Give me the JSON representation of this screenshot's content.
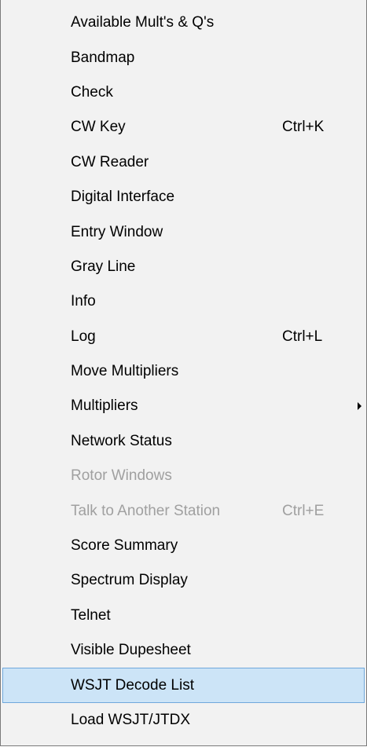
{
  "menu": {
    "items": [
      {
        "label": "Available Mult's & Q's",
        "shortcut": ""
      },
      {
        "label": "Bandmap",
        "shortcut": ""
      },
      {
        "label": "Check",
        "shortcut": ""
      },
      {
        "label": "CW Key",
        "shortcut": "Ctrl+K"
      },
      {
        "label": "CW Reader",
        "shortcut": ""
      },
      {
        "label": "Digital Interface",
        "shortcut": ""
      },
      {
        "label": "Entry Window",
        "shortcut": ""
      },
      {
        "label": "Gray Line",
        "shortcut": ""
      },
      {
        "label": "Info",
        "shortcut": ""
      },
      {
        "label": "Log",
        "shortcut": "Ctrl+L"
      },
      {
        "label": "Move Multipliers",
        "shortcut": ""
      },
      {
        "label": "Multipliers",
        "shortcut": ""
      },
      {
        "label": "Network Status",
        "shortcut": ""
      },
      {
        "label": "Rotor Windows",
        "shortcut": ""
      },
      {
        "label": "Talk to Another Station",
        "shortcut": "Ctrl+E"
      },
      {
        "label": "Score Summary",
        "shortcut": ""
      },
      {
        "label": "Spectrum Display",
        "shortcut": ""
      },
      {
        "label": "Telnet",
        "shortcut": ""
      },
      {
        "label": "Visible Dupesheet",
        "shortcut": ""
      },
      {
        "label": "WSJT Decode List",
        "shortcut": ""
      },
      {
        "label": "Load WSJT/JTDX",
        "shortcut": ""
      }
    ],
    "submenu_arrow_icon": "triangle-right-icon",
    "colors": {
      "background": "#f2f2f2",
      "highlight": "#cce4f7",
      "highlight_border": "#6fa8dc",
      "disabled_text": "#a0a0a0"
    }
  }
}
